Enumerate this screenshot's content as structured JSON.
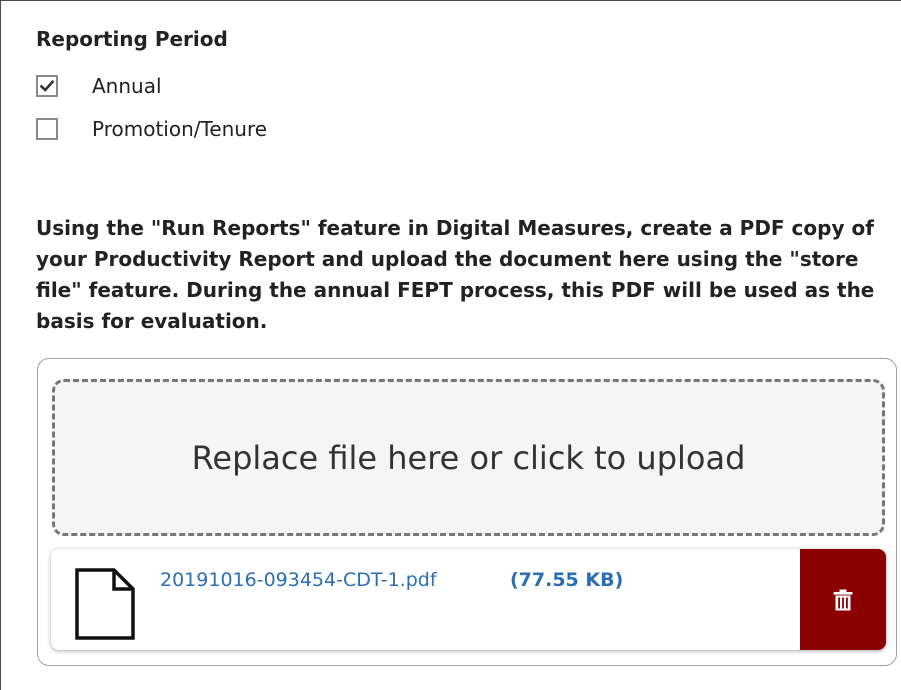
{
  "reporting_period": {
    "heading": "Reporting Period",
    "options": [
      {
        "label": "Annual",
        "checked": true
      },
      {
        "label": "Promotion/Tenure",
        "checked": false
      }
    ]
  },
  "instructions": "Using the \"Run Reports\" feature in Digital Measures, create a PDF copy of your Productivity Report and upload the document here using the \"store file\" feature. During the annual FEPT process, this PDF will be used as the basis for evaluation.",
  "upload": {
    "dropzone_text": "Replace file here or click to upload",
    "file": {
      "icon": "file-icon",
      "name": "20191016-093454-CDT-1.pdf",
      "size": "(77.55 KB)"
    },
    "delete_icon": "trash-icon"
  },
  "colors": {
    "link": "#2a6fb5",
    "delete_bg": "#8b0000",
    "dashed_border": "#777777"
  }
}
